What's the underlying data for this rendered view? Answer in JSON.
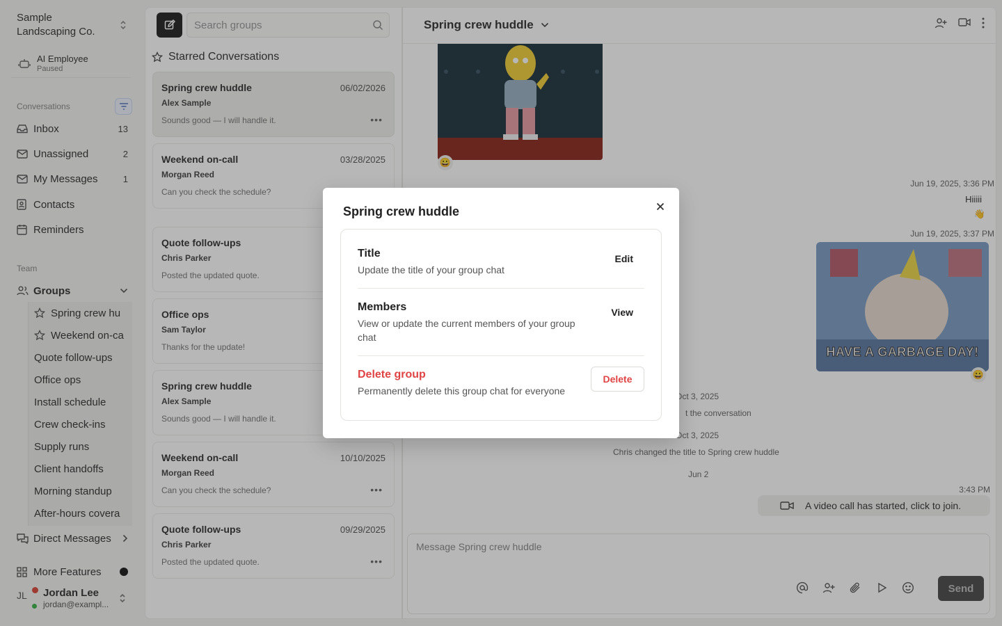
{
  "org": {
    "name": "Sample Landscaping Co."
  },
  "ai_employee": {
    "title": "AI Employee",
    "status": "Paused"
  },
  "sidebar": {
    "conversations_label": "Conversations",
    "nav": [
      {
        "label": "Inbox",
        "count": "13"
      },
      {
        "label": "Unassigned",
        "count": "2"
      },
      {
        "label": "My Messages",
        "count": "1"
      },
      {
        "label": "Contacts",
        "count": ""
      },
      {
        "label": "Reminders",
        "count": ""
      }
    ],
    "team_label": "Team",
    "groups_label": "Groups",
    "groups": [
      {
        "label": "Spring crew hu",
        "starred": true
      },
      {
        "label": "Weekend on-ca",
        "starred": true
      },
      {
        "label": "Quote follow-ups",
        "starred": false
      },
      {
        "label": "Office ops",
        "starred": false
      },
      {
        "label": "Install schedule",
        "starred": false
      },
      {
        "label": "Crew check-ins",
        "starred": false
      },
      {
        "label": "Supply runs",
        "starred": false
      },
      {
        "label": "Client handoffs",
        "starred": false
      },
      {
        "label": "Morning standup",
        "starred": false
      },
      {
        "label": "After-hours covera",
        "starred": false
      }
    ],
    "direct_messages_label": "Direct Messages",
    "more_features_label": "More Features",
    "user": {
      "initials": "JL",
      "name": "Jordan Lee",
      "email": "jordan@exampl..."
    }
  },
  "middle": {
    "search_placeholder": "Search groups",
    "starred_heading": "Starred Conversations",
    "conversations": [
      {
        "title": "Spring crew huddle",
        "date": "06/02/2026",
        "author": "Alex Sample",
        "preview": "Sounds good — I will handle it."
      },
      {
        "title": "Weekend on-call",
        "date": "03/28/2025",
        "author": "Morgan Reed",
        "preview": "Can you check the schedule?"
      },
      {
        "title": "Quote follow-ups",
        "date": "",
        "author": "Chris Parker",
        "preview": "Posted the updated quote."
      },
      {
        "title": "Office ops",
        "date": "",
        "author": "Sam Taylor",
        "preview": "Thanks for the update!"
      },
      {
        "title": "Spring crew huddle",
        "date": "",
        "author": "Alex Sample",
        "preview": "Sounds good — I will handle it."
      },
      {
        "title": "Weekend on-call",
        "date": "10/10/2025",
        "author": "Morgan Reed",
        "preview": "Can you check the schedule?"
      },
      {
        "title": "Quote follow-ups",
        "date": "09/29/2025",
        "author": "Chris Parker",
        "preview": "Posted the updated quote."
      }
    ]
  },
  "chat": {
    "title": "Spring crew huddle",
    "timestamps": {
      "t1": "Jun 19, 2025, 3:36 PM",
      "t2": "Jun 19, 2025, 3:37 PM",
      "t3": "Oct 3, 2025",
      "t4": "Oct 3, 2025",
      "t5": "Jun 2",
      "t6": "3:43 PM"
    },
    "message_hi": "Hiiiii",
    "gif_caption": "HAVE A GARBAGE DAY!",
    "system_1": "t the conversation",
    "system_2": "Chris changed the title to Spring crew huddle",
    "video_call": "A video call has started, click to join.",
    "composer_placeholder": "Message Spring crew huddle",
    "send_label": "Send"
  },
  "modal": {
    "title": "Spring crew huddle",
    "title_row": {
      "label": "Title",
      "desc": "Update the title of your group chat",
      "action": "Edit"
    },
    "members_row": {
      "label": "Members",
      "desc": "View or update the current members of your group chat",
      "action": "View"
    },
    "delete_row": {
      "label": "Delete group",
      "desc": "Permanently delete this group chat for everyone",
      "action": "Delete"
    }
  },
  "colors": {
    "danger": "#e04444",
    "accent": "#5577bb",
    "primary_dark": "#222222"
  }
}
